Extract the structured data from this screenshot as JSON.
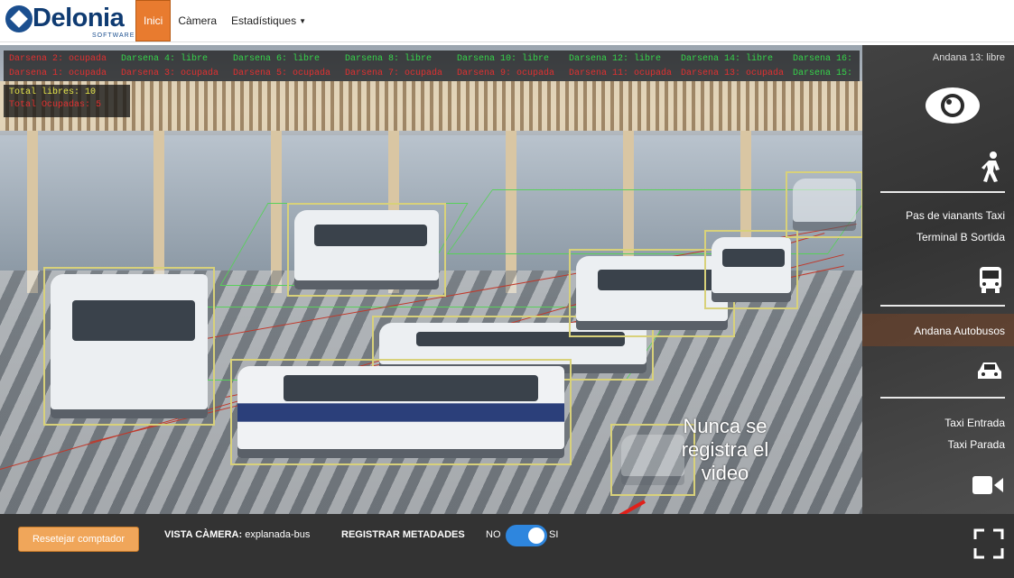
{
  "brand": {
    "name": "Delonia",
    "sub": "SOFTWARE"
  },
  "nav": {
    "items": [
      "Inici",
      "Càmera",
      "Estadístiques"
    ]
  },
  "status": {
    "row1": [
      "Darsena 2: ocupada",
      "Darsena 4: libre",
      "Darsena 6: libre",
      "Darsena 8: libre",
      "Darsena 10: libre",
      "Darsena 12: libre",
      "Darsena 14: libre",
      "Darsena 16:"
    ],
    "row2": [
      "Darsena 1: ocupada",
      "Darsena 3: ocupada",
      "Darsena 5: ocupada",
      "Darsena 7: ocupada",
      "Darsena 9: ocupada",
      "Darsena 11: ocupada",
      "Darsena 13: ocupada",
      "Darsena 15:"
    ],
    "row1_states": [
      "busy",
      "free",
      "free",
      "free",
      "free",
      "free",
      "free",
      "free"
    ],
    "row2_states": [
      "busy",
      "busy",
      "busy",
      "busy",
      "busy",
      "busy",
      "busy",
      "free"
    ],
    "total_free": "Total libres: 10",
    "total_busy": "Total Ocupadas: 5",
    "extra": "Andana 13: libre"
  },
  "annotation": "Nunca se registra el video",
  "right_panel": {
    "pedestrians": [
      "Pas de vianants Taxi",
      "Terminal B Sortida"
    ],
    "bus_lane": "Andana Autobusos",
    "taxi": [
      "Taxi Entrada",
      "Taxi Parada"
    ]
  },
  "bottom": {
    "reset": "Resetejar comptador",
    "view_label": "VISTA CÀMERA:",
    "view_value": "explanada-bus",
    "record_label": "REGISTRAR METADADES",
    "no": "NO",
    "si": "SI"
  },
  "colors": {
    "accent": "#e87b2f",
    "free": "#36d24a",
    "busy": "#e03030",
    "toggle": "#2e86de"
  }
}
